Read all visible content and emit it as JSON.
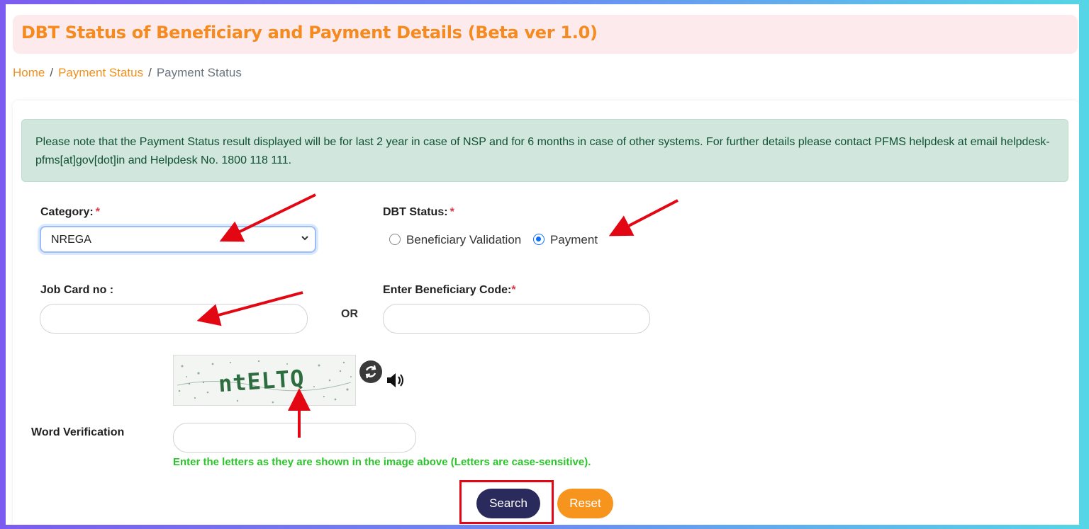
{
  "header": {
    "title": "DBT Status of Beneficiary and Payment Details (Beta ver 1.0)"
  },
  "breadcrumb": {
    "home": "Home",
    "separator": "/",
    "parent": "Payment Status",
    "current": "Payment Status"
  },
  "notice": {
    "text": "Please note that the Payment Status result displayed will be for last 2 year in case of NSP and for 6 months in case of other systems. For further details please contact PFMS helpdesk at email helpdesk-pfms[at]gov[dot]in and Helpdesk No. 1800 118 111."
  },
  "form": {
    "category": {
      "label": "Category:",
      "required_mark": "*",
      "value": "NREGA"
    },
    "dbt_status": {
      "label": "DBT Status:",
      "required_mark": "*",
      "options": [
        {
          "label": "Beneficiary Validation",
          "checked": false
        },
        {
          "label": "Payment",
          "checked": true
        }
      ]
    },
    "job_card": {
      "label": "Job Card no :",
      "value": ""
    },
    "or_text": "OR",
    "beneficiary_code": {
      "label": "Enter Beneficiary Code:",
      "required_mark": "*",
      "value": ""
    },
    "captcha": {
      "text": "ntELTQ"
    },
    "word_verification": {
      "label": "Word Verification",
      "value": ""
    },
    "hint": "Enter the letters as they are shown in the image above (Letters are case-sensitive).",
    "search_label": "Search",
    "reset_label": "Reset"
  },
  "icons": {
    "refresh": "refresh-icon",
    "speaker": "speaker-icon",
    "chevron": "chevron-down-icon"
  },
  "colors": {
    "title": "#f58a1f",
    "title_bg": "#fdeaec",
    "alert_bg": "#d1e7dd",
    "alert_text": "#0f5132",
    "search_btn": "#2a2a5c",
    "reset_btn": "#f7941d",
    "hint": "#2bc42b",
    "annotation": "#e30613"
  }
}
